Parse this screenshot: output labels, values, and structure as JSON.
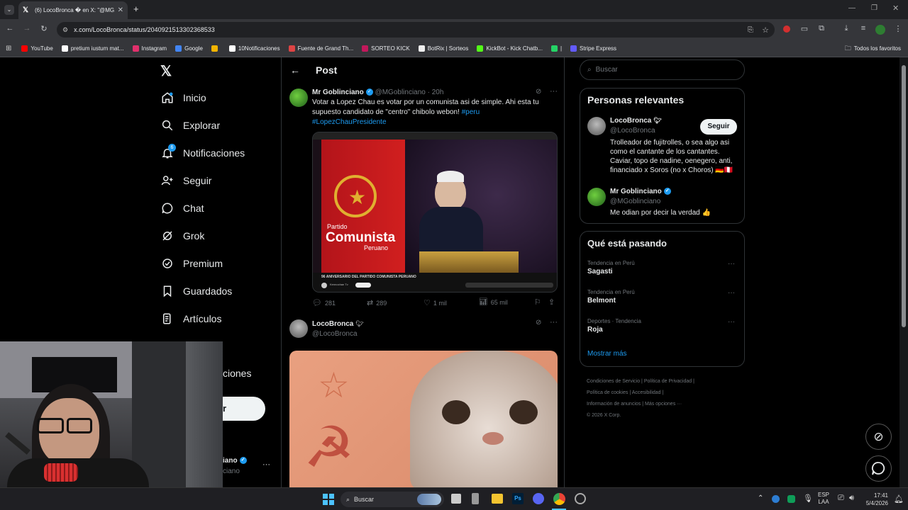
{
  "browser": {
    "tab_title": "(6) LocoBronca � en X: \"@MG...",
    "url": "x.com/LocoBronca/status/2040921513302368533",
    "bookmarks": [
      "YouTube",
      "pretium iustum mat...",
      "Instagram",
      "Google",
      "",
      "10Notificaciones",
      "Fuente de Grand Th...",
      "SORTEO KICK",
      "BotRix | Sorteos",
      "KickBot - Kick Chatb...",
      "|",
      "Stripe Express"
    ],
    "bookmark_colors": [
      "#ff0000",
      "#fff",
      "#e1306c",
      "#4285f4",
      "#f4b400",
      "#fff",
      "#d44",
      "#c2185b",
      "#eee",
      "#53fc18",
      "#25d366",
      "#635bff"
    ],
    "all_favorites": "Todos los favoritos"
  },
  "nav": {
    "items": [
      "Inicio",
      "Explorar",
      "Notificaciones",
      "Seguir",
      "Chat",
      "Grok",
      "Premium",
      "Guardados",
      "Artículos"
    ],
    "partial_item": "ciones",
    "post_button_partial": "r",
    "notif_badge": "6",
    "account_name_partial": "iano",
    "account_handle_partial": "ciano",
    "more": "···"
  },
  "post_header": {
    "title": "Post"
  },
  "tweet1": {
    "name": "Mr Goblinciano",
    "handle": "@MGoblinciano",
    "time": "· 20h",
    "text": "Votar a Lopez Chau es votar por un comunista asi de simple. Ahi esta tu supuesto candidato de \"centro\" chibolo webon! ",
    "hashtag1": "#peru",
    "hashtag2": "#LopezChauPresidente",
    "image_caption": "96 ANIVERSARIO DEL PARTIDO COMUNISTA PERUANO",
    "party_line1": "Partido",
    "party_line2": "Comunista",
    "party_line3": "Peruano",
    "channel": "Kennochan Tv",
    "stats": {
      "replies": "281",
      "reposts": "289",
      "likes": "1 mil",
      "views": "65 mil"
    }
  },
  "tweet2": {
    "name": "LocoBronca",
    "handle": "@LocoBronca"
  },
  "search": {
    "placeholder": "Buscar"
  },
  "relevant": {
    "title": "Personas relevantes",
    "people": [
      {
        "name": "LocoBronca",
        "handle": "@LocoBronca",
        "follow": "Seguir",
        "bio": "Trolleador de fujitrolles, o sea algo asi como el cantante de los cantantes. Caviar, topo de nadine, oenegero, anti, financiado x Soros (no x Choros) 🇩🇪🇵🇪"
      },
      {
        "name": "Mr Goblinciano",
        "handle": "@MGoblinciano",
        "bio": "Me odian por decir la verdad 👍"
      }
    ]
  },
  "trends": {
    "title": "Qué está pasando",
    "items": [
      {
        "context": "Tendencia en Perú",
        "name": "Sagasti"
      },
      {
        "context": "Tendencia en Perú",
        "name": "Belmont"
      },
      {
        "context": "Deportes · Tendencia",
        "name": "Roja"
      }
    ],
    "show_more": "Mostrar más"
  },
  "footer": {
    "links": [
      "Condiciones de Servicio",
      "Política de Privacidad",
      "Política de cookies",
      "Accesibilidad",
      "Información de anuncios",
      "Más opciones ···"
    ],
    "copyright": "© 2026 X Corp."
  },
  "taskbar": {
    "search": "Buscar",
    "lang1": "ESP",
    "lang2": "LAA",
    "time": "17:41",
    "date": "5/4/2026"
  }
}
